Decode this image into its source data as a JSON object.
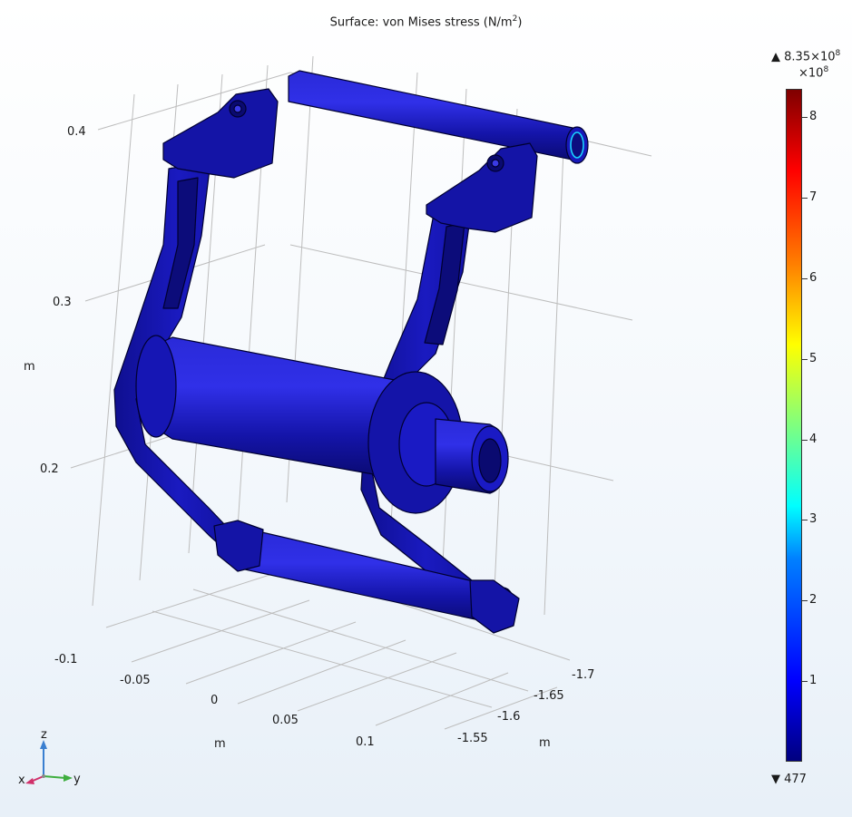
{
  "title": {
    "prefix": "Surface: von Mises stress (N/m",
    "sup": "2",
    "suffix": ")"
  },
  "axes": {
    "z": {
      "ticks": [
        "0.4",
        "0.3",
        "0.2"
      ],
      "unit": "m"
    },
    "x": {
      "ticks": [
        "-0.1",
        "-0.05",
        "0",
        "0.05",
        "0.1"
      ],
      "unit": "m"
    },
    "y": {
      "ticks": [
        "-1.7",
        "-1.65",
        "-1.6",
        "-1.55"
      ],
      "unit": "m"
    }
  },
  "colorbar": {
    "max_label": {
      "mantissa": "8.35×10",
      "exp": "8"
    },
    "factor": {
      "base": "×10",
      "exp": "8"
    },
    "min_label": "477",
    "ticks": [
      "8",
      "7",
      "6",
      "5",
      "4",
      "3",
      "2",
      "1"
    ],
    "tick_values": [
      8,
      7,
      6,
      5,
      4,
      3,
      2,
      1
    ],
    "range": [
      0,
      8.35
    ],
    "colors": [
      "#00007f",
      "#0000ff",
      "#007fff",
      "#00ffff",
      "#7fff7f",
      "#ffff00",
      "#ff7f00",
      "#ff0000",
      "#7f0000"
    ]
  },
  "triad": {
    "z": "z",
    "x": "x",
    "y": "y"
  },
  "colors": {
    "part_fill": "#1616b4",
    "part_dark": "#0a0a6e",
    "part_edge": "#000030",
    "part_highlight": "#3a3ae6",
    "accent_cyan": "#19d4ff"
  }
}
